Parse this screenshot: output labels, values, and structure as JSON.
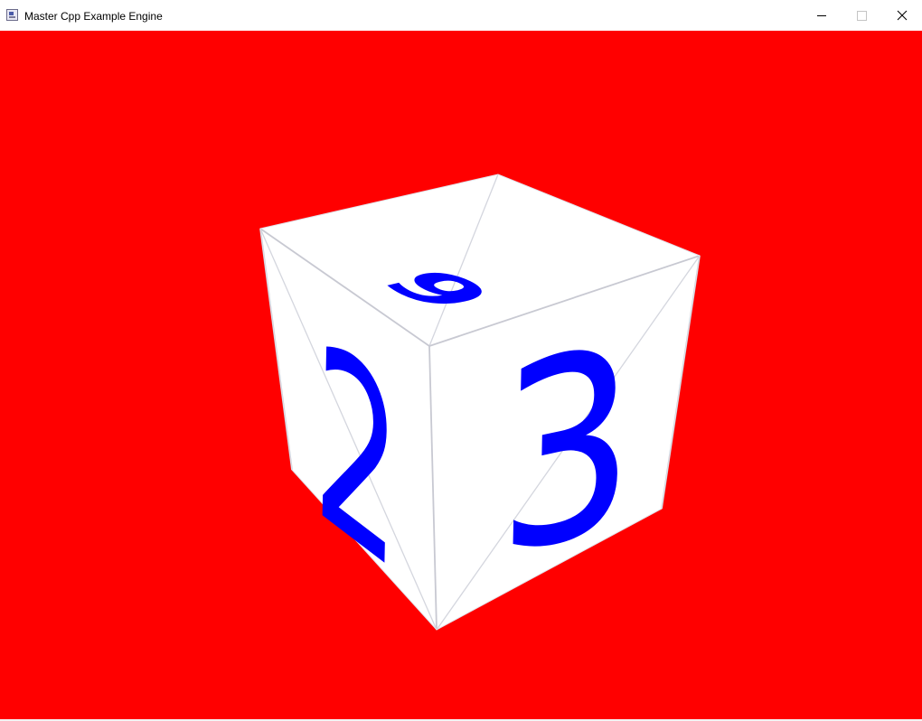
{
  "window": {
    "title": "Master Cpp Example Engine",
    "controls": {
      "minimize": "minimize-icon",
      "maximize": "maximize-icon",
      "close": "close-icon"
    }
  },
  "scene": {
    "background_color": "#ff0000",
    "object": "cube",
    "cube_face_color": "#ffffff",
    "edge_color": "#c8c8d2",
    "numeral_color": "#0000ff",
    "faces": {
      "top": "6",
      "left": "2",
      "front": "3"
    }
  }
}
